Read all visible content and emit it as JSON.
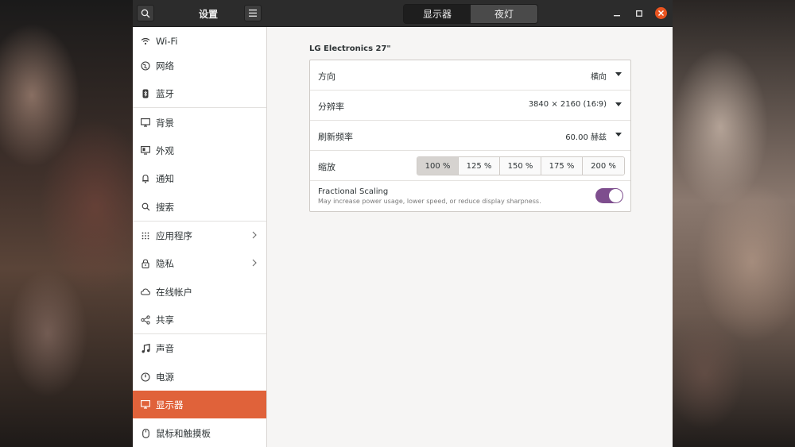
{
  "header": {
    "title": "设置",
    "tabs": [
      {
        "label": "显示器",
        "active": true
      },
      {
        "label": "夜灯",
        "active": false
      }
    ]
  },
  "sidebar": {
    "items": [
      {
        "label": "Wi-Fi",
        "icon": "wifi-icon"
      },
      {
        "label": "网络",
        "icon": "network-icon"
      },
      {
        "label": "蓝牙",
        "icon": "bluetooth-icon"
      },
      {
        "label": "背景",
        "icon": "background-icon"
      },
      {
        "label": "外观",
        "icon": "appearance-icon"
      },
      {
        "label": "通知",
        "icon": "bell-icon"
      },
      {
        "label": "搜索",
        "icon": "search-icon"
      },
      {
        "label": "应用程序",
        "icon": "apps-icon",
        "arrow": true
      },
      {
        "label": "隐私",
        "icon": "lock-icon",
        "arrow": true
      },
      {
        "label": "在线帐户",
        "icon": "cloud-icon"
      },
      {
        "label": "共享",
        "icon": "share-icon"
      },
      {
        "label": "声音",
        "icon": "music-icon"
      },
      {
        "label": "电源",
        "icon": "power-icon"
      },
      {
        "label": "显示器",
        "icon": "display-icon",
        "active": true
      },
      {
        "label": "鼠标和触摸板",
        "icon": "mouse-icon"
      }
    ]
  },
  "display": {
    "monitor_name": "LG Electronics 27\"",
    "orientation": {
      "label": "方向",
      "value": "横向"
    },
    "resolution": {
      "label": "分辨率",
      "value": "3840 × 2160 (16∶9)"
    },
    "refresh_rate": {
      "label": "刷新频率",
      "value": "60.00 赫兹"
    },
    "scale": {
      "label": "缩放",
      "options": [
        "100 %",
        "125 %",
        "150 %",
        "175 %",
        "200 %"
      ],
      "selected": "100 %"
    },
    "fractional_scaling": {
      "title": "Fractional Scaling",
      "subtitle": "May increase power usage, lower speed, or reduce display sharpness.",
      "enabled": true
    }
  },
  "colors": {
    "accent": "#e0623a",
    "toggle": "#7e4e8e",
    "headerbar": "#2c2c2c"
  }
}
